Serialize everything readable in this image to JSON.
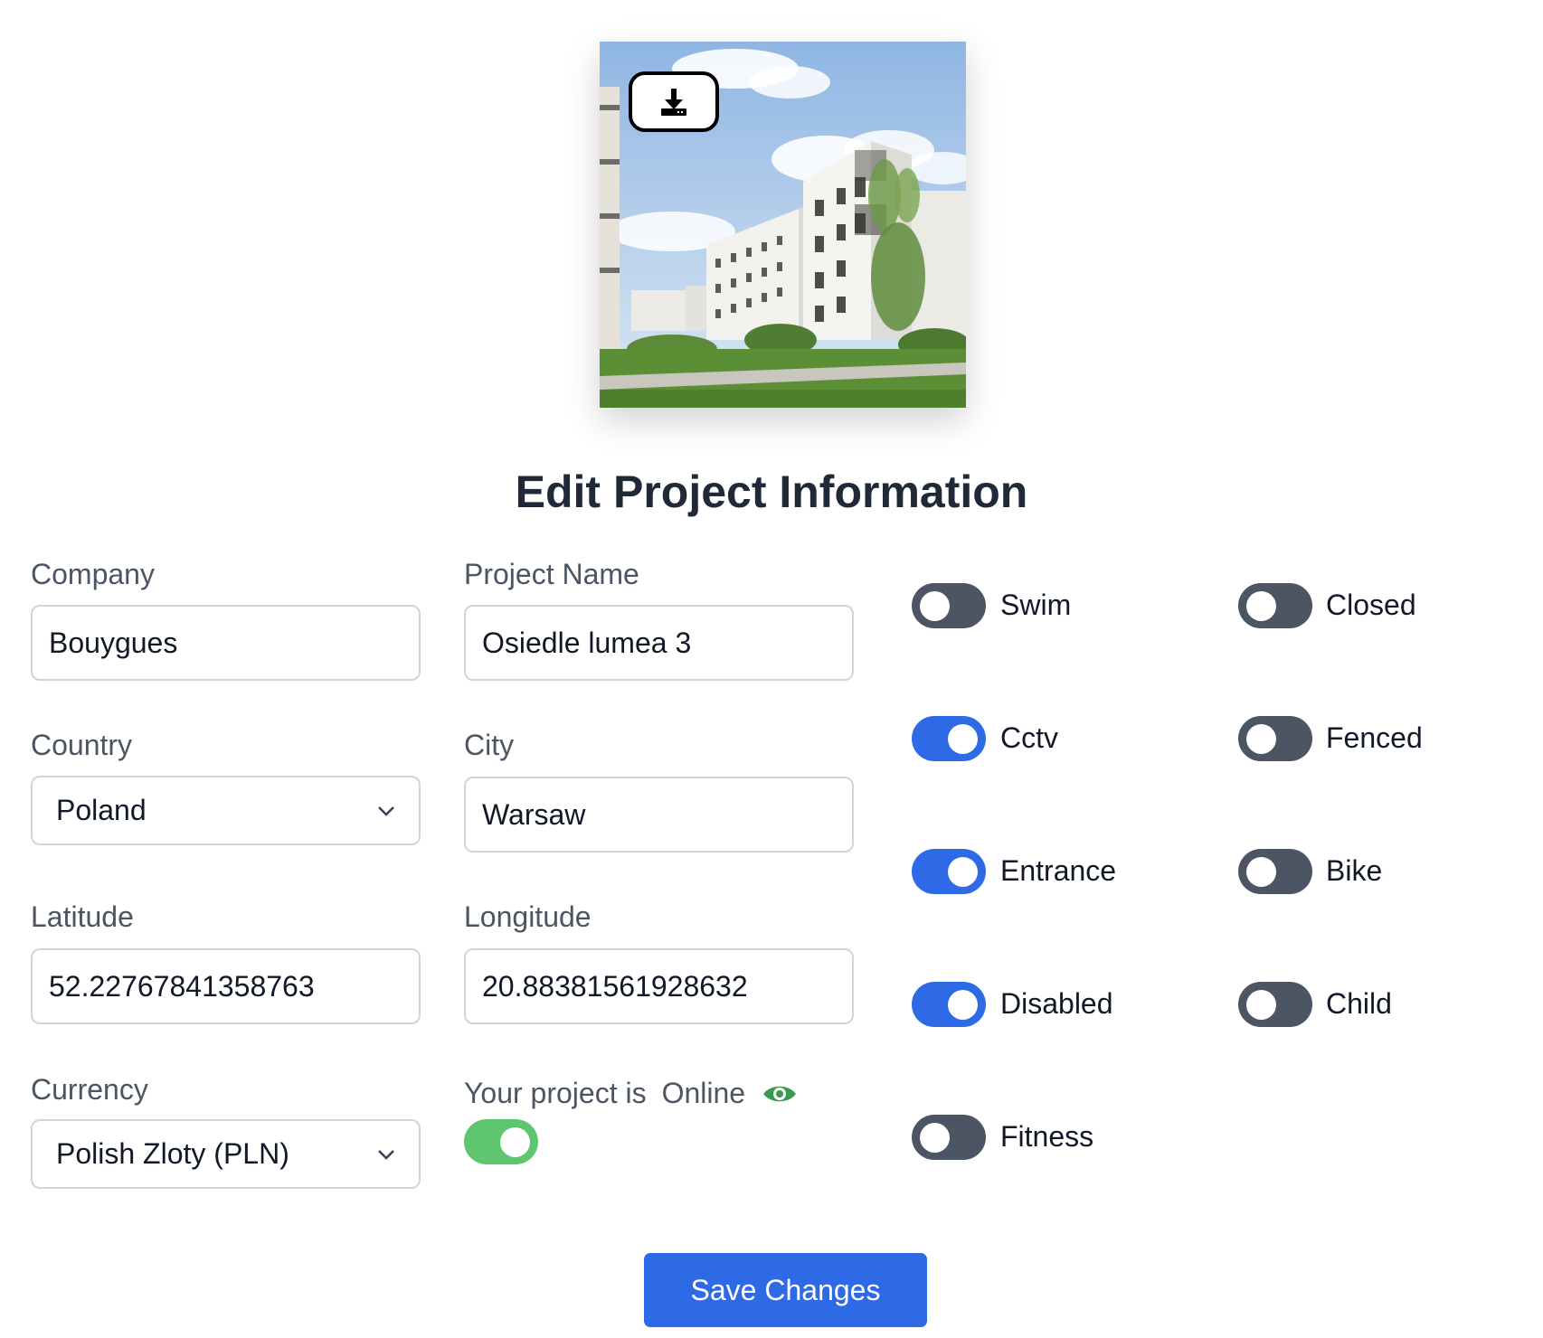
{
  "header": {
    "image_alt": "Project rendering of residential buildings",
    "download_icon": "download-icon",
    "title": "Edit Project Information"
  },
  "form": {
    "company": {
      "label": "Company",
      "value": "Bouygues"
    },
    "project_name": {
      "label": "Project Name",
      "value": "Osiedle lumea 3"
    },
    "country": {
      "label": "Country",
      "value": "Poland"
    },
    "city": {
      "label": "City",
      "value": "Warsaw"
    },
    "latitude": {
      "label": "Latitude",
      "value": "52.22767841358763"
    },
    "longitude": {
      "label": "Longitude",
      "value": "20.88381561928632"
    },
    "currency": {
      "label": "Currency",
      "value": "Polish Zloty (PLN)"
    },
    "status": {
      "prefix": "Your project is",
      "state": "Online",
      "icon": "eye-icon",
      "enabled": true
    }
  },
  "amenities": [
    {
      "label": "Swim",
      "on": false
    },
    {
      "label": "Closed",
      "on": false
    },
    {
      "label": "Cctv",
      "on": true
    },
    {
      "label": "Fenced",
      "on": false
    },
    {
      "label": "Entrance",
      "on": true
    },
    {
      "label": "Bike",
      "on": false
    },
    {
      "label": "Disabled",
      "on": true
    },
    {
      "label": "Child",
      "on": false
    },
    {
      "label": "Fitness",
      "on": false
    }
  ],
  "actions": {
    "save_label": "Save Changes"
  },
  "colors": {
    "primary": "#2f6ae6",
    "toggle_off": "#4b5563",
    "online_green": "#5ec66e",
    "eye_green": "#3a9a4e",
    "title": "#1f2937",
    "label": "#4b5563"
  }
}
